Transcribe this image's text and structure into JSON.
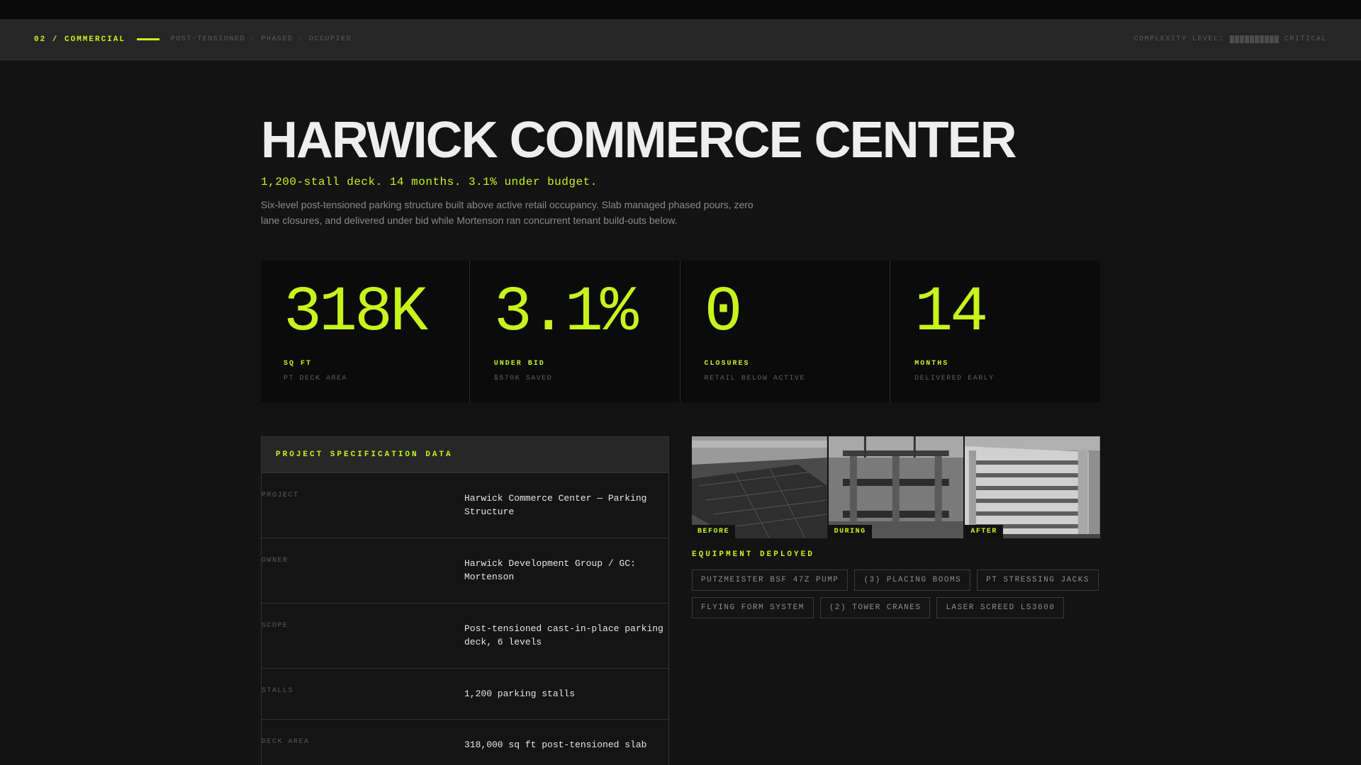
{
  "header": {
    "section": "02 / COMMERCIAL",
    "tags": "POST-TENSIONED · PHASED · OCCUPIED",
    "complexity_label": "COMPLEXITY LEVEL:",
    "complexity_level": "CRITICAL",
    "complexity_segments": 10
  },
  "hero": {
    "title": "HARWICK COMMERCE CENTER",
    "tagline": "1,200-stall deck. 14 months. 3.1% under budget.",
    "description": "Six-level post-tensioned parking structure built above active retail occupancy. Slab managed phased pours, zero lane closures, and delivered under bid while Mortenson ran concurrent tenant build-outs below."
  },
  "stats": [
    {
      "value": "318K",
      "label": "SQ FT",
      "sub": "PT DECK AREA"
    },
    {
      "value": "3.1%",
      "label": "UNDER BID",
      "sub": "$570K SAVED"
    },
    {
      "value": "0",
      "label": "CLOSURES",
      "sub": "RETAIL BELOW ACTIVE"
    },
    {
      "value": "14",
      "label": "MONTHS",
      "sub": "DELIVERED EARLY"
    }
  ],
  "spec": {
    "title": "PROJECT SPECIFICATION DATA",
    "rows": [
      {
        "key": "PROJECT",
        "value": "Harwick Commerce Center — Parking Structure"
      },
      {
        "key": "OWNER",
        "value": "Harwick Development Group / GC: Mortenson"
      },
      {
        "key": "SCOPE",
        "value": "Post-tensioned cast-in-place parking deck, 6 levels"
      },
      {
        "key": "STALLS",
        "value": "1,200 parking stalls"
      },
      {
        "key": "DECK AREA",
        "value": "318,000 sq ft post-tensioned slab"
      }
    ]
  },
  "photos": [
    {
      "tag": "BEFORE"
    },
    {
      "tag": "DURING"
    },
    {
      "tag": "AFTER"
    }
  ],
  "equipment": {
    "title": "EQUIPMENT DEPLOYED",
    "items": [
      "PUTZMEISTER BSF 47Z PUMP",
      "(3) PLACING BOOMS",
      "PT STRESSING JACKS",
      "FLYING FORM SYSTEM",
      "(2) TOWER CRANES",
      "LASER SCREED LS3600"
    ]
  },
  "colors": {
    "accent": "#c8f31d",
    "background": "#131313",
    "header": "#262626"
  }
}
